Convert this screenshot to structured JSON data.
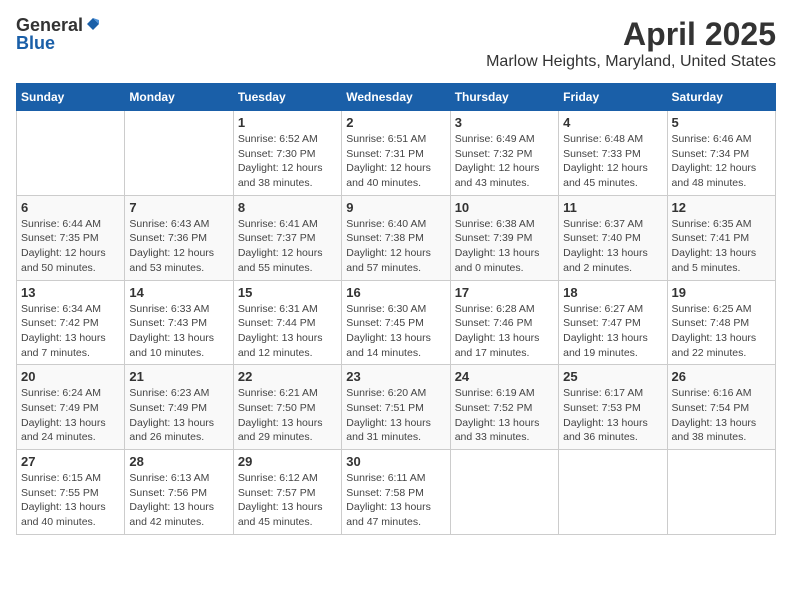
{
  "header": {
    "logo_general": "General",
    "logo_blue": "Blue",
    "title": "April 2025",
    "subtitle": "Marlow Heights, Maryland, United States"
  },
  "calendar": {
    "days_of_week": [
      "Sunday",
      "Monday",
      "Tuesday",
      "Wednesday",
      "Thursday",
      "Friday",
      "Saturday"
    ],
    "weeks": [
      [
        {
          "day": "",
          "info": ""
        },
        {
          "day": "",
          "info": ""
        },
        {
          "day": "1",
          "info": "Sunrise: 6:52 AM\nSunset: 7:30 PM\nDaylight: 12 hours and 38 minutes."
        },
        {
          "day": "2",
          "info": "Sunrise: 6:51 AM\nSunset: 7:31 PM\nDaylight: 12 hours and 40 minutes."
        },
        {
          "day": "3",
          "info": "Sunrise: 6:49 AM\nSunset: 7:32 PM\nDaylight: 12 hours and 43 minutes."
        },
        {
          "day": "4",
          "info": "Sunrise: 6:48 AM\nSunset: 7:33 PM\nDaylight: 12 hours and 45 minutes."
        },
        {
          "day": "5",
          "info": "Sunrise: 6:46 AM\nSunset: 7:34 PM\nDaylight: 12 hours and 48 minutes."
        }
      ],
      [
        {
          "day": "6",
          "info": "Sunrise: 6:44 AM\nSunset: 7:35 PM\nDaylight: 12 hours and 50 minutes."
        },
        {
          "day": "7",
          "info": "Sunrise: 6:43 AM\nSunset: 7:36 PM\nDaylight: 12 hours and 53 minutes."
        },
        {
          "day": "8",
          "info": "Sunrise: 6:41 AM\nSunset: 7:37 PM\nDaylight: 12 hours and 55 minutes."
        },
        {
          "day": "9",
          "info": "Sunrise: 6:40 AM\nSunset: 7:38 PM\nDaylight: 12 hours and 57 minutes."
        },
        {
          "day": "10",
          "info": "Sunrise: 6:38 AM\nSunset: 7:39 PM\nDaylight: 13 hours and 0 minutes."
        },
        {
          "day": "11",
          "info": "Sunrise: 6:37 AM\nSunset: 7:40 PM\nDaylight: 13 hours and 2 minutes."
        },
        {
          "day": "12",
          "info": "Sunrise: 6:35 AM\nSunset: 7:41 PM\nDaylight: 13 hours and 5 minutes."
        }
      ],
      [
        {
          "day": "13",
          "info": "Sunrise: 6:34 AM\nSunset: 7:42 PM\nDaylight: 13 hours and 7 minutes."
        },
        {
          "day": "14",
          "info": "Sunrise: 6:33 AM\nSunset: 7:43 PM\nDaylight: 13 hours and 10 minutes."
        },
        {
          "day": "15",
          "info": "Sunrise: 6:31 AM\nSunset: 7:44 PM\nDaylight: 13 hours and 12 minutes."
        },
        {
          "day": "16",
          "info": "Sunrise: 6:30 AM\nSunset: 7:45 PM\nDaylight: 13 hours and 14 minutes."
        },
        {
          "day": "17",
          "info": "Sunrise: 6:28 AM\nSunset: 7:46 PM\nDaylight: 13 hours and 17 minutes."
        },
        {
          "day": "18",
          "info": "Sunrise: 6:27 AM\nSunset: 7:47 PM\nDaylight: 13 hours and 19 minutes."
        },
        {
          "day": "19",
          "info": "Sunrise: 6:25 AM\nSunset: 7:48 PM\nDaylight: 13 hours and 22 minutes."
        }
      ],
      [
        {
          "day": "20",
          "info": "Sunrise: 6:24 AM\nSunset: 7:49 PM\nDaylight: 13 hours and 24 minutes."
        },
        {
          "day": "21",
          "info": "Sunrise: 6:23 AM\nSunset: 7:49 PM\nDaylight: 13 hours and 26 minutes."
        },
        {
          "day": "22",
          "info": "Sunrise: 6:21 AM\nSunset: 7:50 PM\nDaylight: 13 hours and 29 minutes."
        },
        {
          "day": "23",
          "info": "Sunrise: 6:20 AM\nSunset: 7:51 PM\nDaylight: 13 hours and 31 minutes."
        },
        {
          "day": "24",
          "info": "Sunrise: 6:19 AM\nSunset: 7:52 PM\nDaylight: 13 hours and 33 minutes."
        },
        {
          "day": "25",
          "info": "Sunrise: 6:17 AM\nSunset: 7:53 PM\nDaylight: 13 hours and 36 minutes."
        },
        {
          "day": "26",
          "info": "Sunrise: 6:16 AM\nSunset: 7:54 PM\nDaylight: 13 hours and 38 minutes."
        }
      ],
      [
        {
          "day": "27",
          "info": "Sunrise: 6:15 AM\nSunset: 7:55 PM\nDaylight: 13 hours and 40 minutes."
        },
        {
          "day": "28",
          "info": "Sunrise: 6:13 AM\nSunset: 7:56 PM\nDaylight: 13 hours and 42 minutes."
        },
        {
          "day": "29",
          "info": "Sunrise: 6:12 AM\nSunset: 7:57 PM\nDaylight: 13 hours and 45 minutes."
        },
        {
          "day": "30",
          "info": "Sunrise: 6:11 AM\nSunset: 7:58 PM\nDaylight: 13 hours and 47 minutes."
        },
        {
          "day": "",
          "info": ""
        },
        {
          "day": "",
          "info": ""
        },
        {
          "day": "",
          "info": ""
        }
      ]
    ]
  }
}
